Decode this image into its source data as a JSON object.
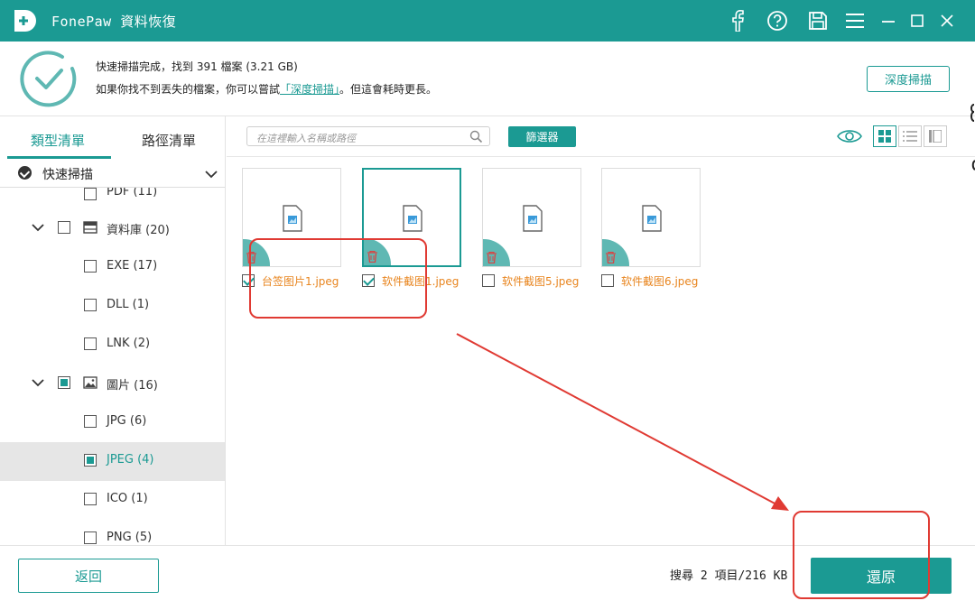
{
  "window": {
    "title": "FonePaw 資料恢復",
    "accent_color": "#1b9a93",
    "icons": [
      "facebook-icon",
      "help-icon",
      "save-icon",
      "menu-icon",
      "minimize-icon",
      "maximize-icon",
      "close-icon"
    ]
  },
  "status": {
    "line1": "快速掃描完成，找到 391 檔案 (3.21 GB)",
    "line2_prefix": "如果你找不到丟失的檔案，你可以嘗試",
    "line2_link": "「深度掃描」",
    "line2_suffix": "。但這會耗時更長。",
    "deep_scan_button": "深度掃描"
  },
  "sidebar": {
    "tabs": [
      {
        "label": "類型清單",
        "active": true
      },
      {
        "label": "路徑清單",
        "active": false
      }
    ],
    "scan_mode": "快速掃描",
    "items": [
      {
        "label": "PDF (11)",
        "checked": false
      },
      {
        "label": "資料庫  (20)",
        "expandable": true,
        "checked": false
      },
      {
        "label": "EXE (17)",
        "checked": false
      },
      {
        "label": "DLL (1)",
        "checked": false
      },
      {
        "label": "LNK (2)",
        "checked": false
      },
      {
        "label": "圖片 (16)",
        "expandable": true,
        "checked": "partial"
      },
      {
        "label": "JPG (6)",
        "checked": false
      },
      {
        "label": "JPEG (4)",
        "checked": "partial",
        "selected": true
      },
      {
        "label": "ICO (1)",
        "checked": false
      },
      {
        "label": "PNG (5)",
        "checked": false
      }
    ]
  },
  "toolbar": {
    "search_placeholder": "在這裡輸入名稱或路徑",
    "filter_button": "篩選器",
    "view_modes": [
      "grid-view",
      "list-view",
      "detail-view"
    ],
    "active_view": "grid-view"
  },
  "files": [
    {
      "name": "台签图片1.jpeg",
      "checked": true
    },
    {
      "name": "软件截图1.jpeg",
      "checked": true
    },
    {
      "name": "软件截图5.jpeg",
      "checked": false
    },
    {
      "name": "软件截图6.jpeg",
      "checked": false
    }
  ],
  "footer": {
    "back_button": "返回",
    "summary": "搜尋 2 項目/216 KB",
    "restore_button": "還原"
  },
  "annotation_color": "#e03a33"
}
